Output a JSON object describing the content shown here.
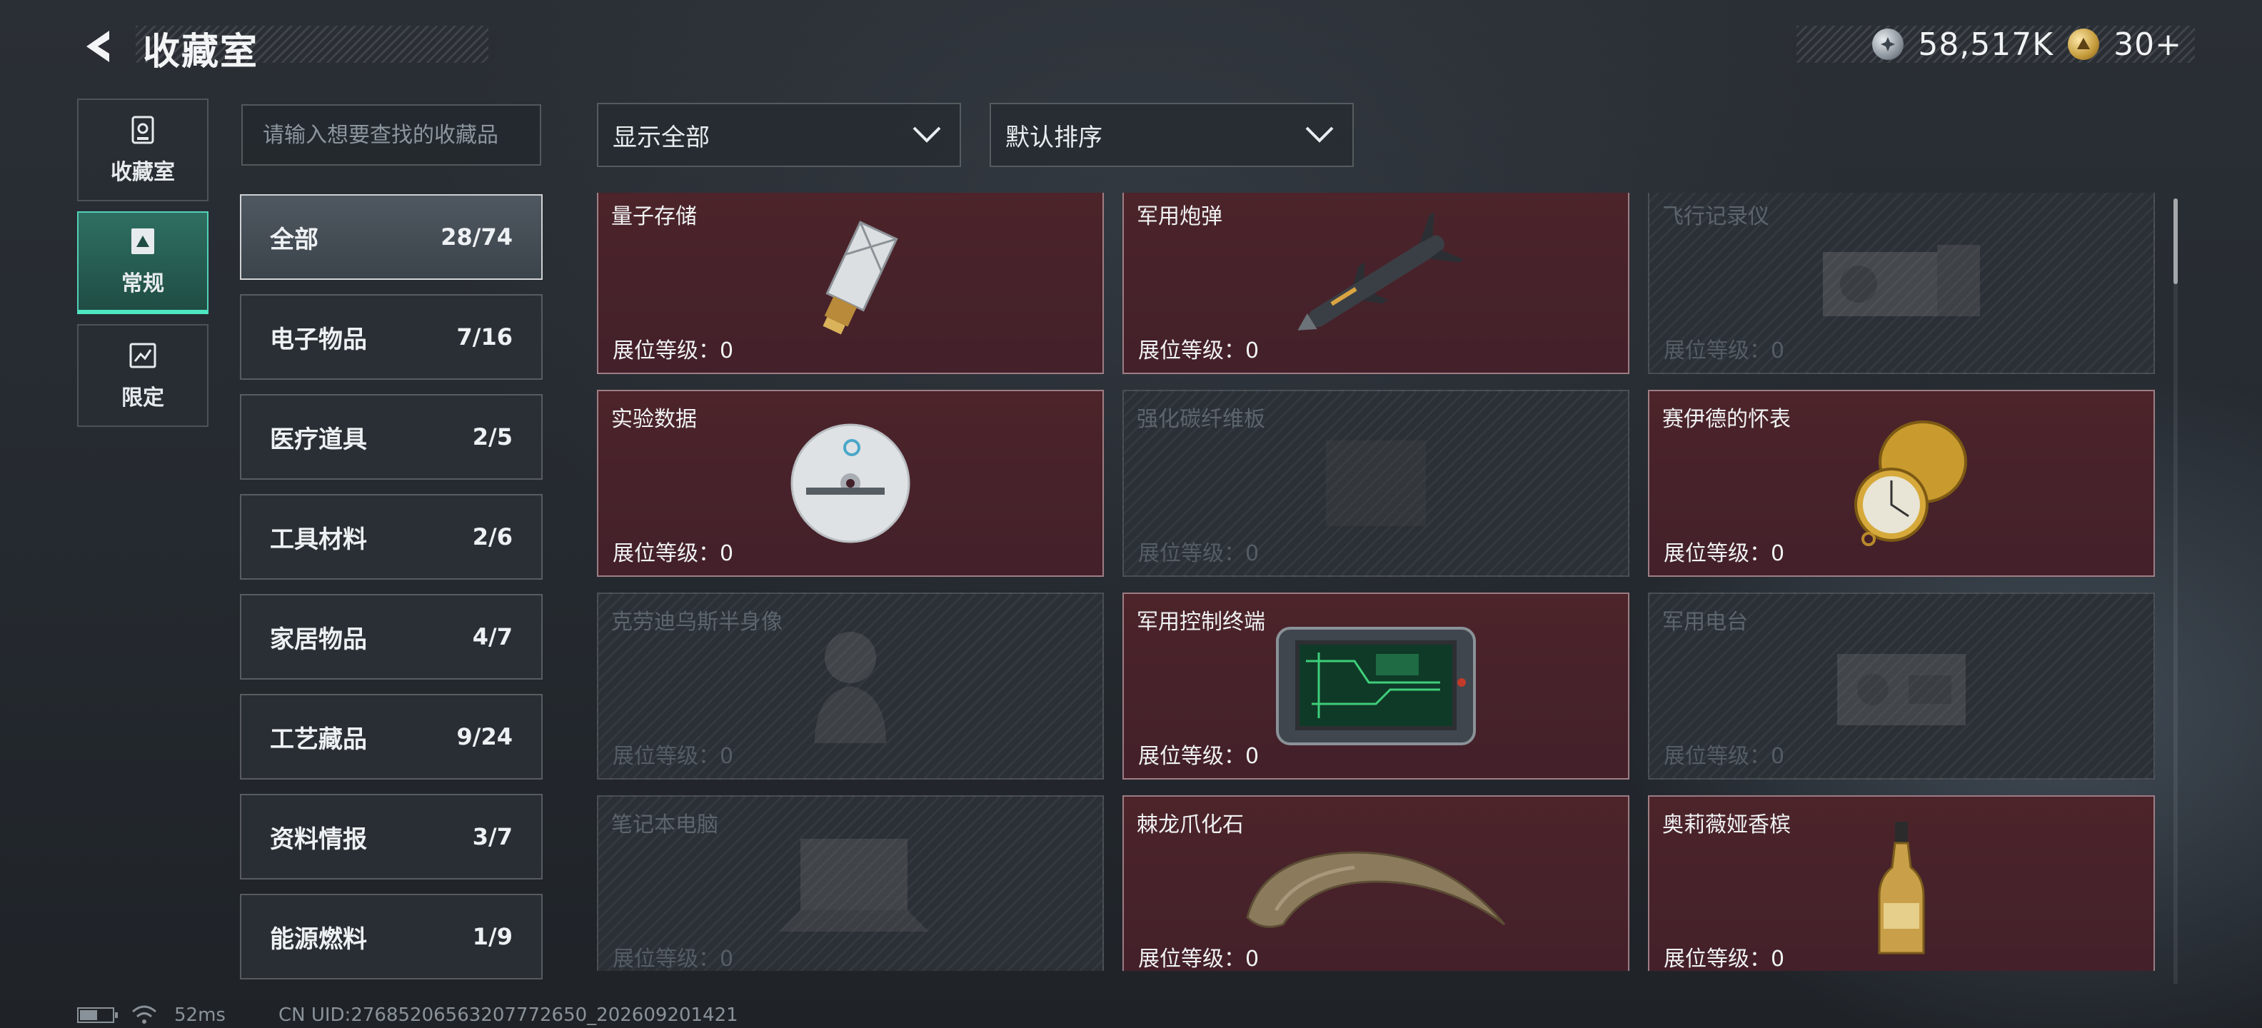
{
  "header": {
    "title": "收藏室",
    "currency": [
      {
        "icon": "silver-coin-icon",
        "value": "58,517K"
      },
      {
        "icon": "gold-coin-icon",
        "value": "30+"
      }
    ]
  },
  "left_nav": [
    {
      "label": "收藏室",
      "icon": "collection-room-icon",
      "active": false
    },
    {
      "label": "常规",
      "icon": "regular-icon",
      "active": true
    },
    {
      "label": "限定",
      "icon": "limited-icon",
      "active": false
    }
  ],
  "search": {
    "placeholder": "请输入想要查找的收藏品",
    "value": ""
  },
  "filters": {
    "filter_label": "显示全部",
    "sort_label": "默认排序"
  },
  "categories": [
    {
      "name": "全部",
      "count": "28/74",
      "active": true
    },
    {
      "name": "电子物品",
      "count": "7/16"
    },
    {
      "name": "医疗道具",
      "count": "2/5"
    },
    {
      "name": "工具材料",
      "count": "2/6"
    },
    {
      "name": "家居物品",
      "count": "4/7"
    },
    {
      "name": "工艺藏品",
      "count": "9/24"
    },
    {
      "name": "资料情报",
      "count": "3/7"
    },
    {
      "name": "能源燃料",
      "count": "1/9"
    }
  ],
  "items": [
    {
      "name": "量子存储",
      "level": "展位等级：0",
      "owned": true,
      "art": "usb-drive-icon"
    },
    {
      "name": "军用炮弹",
      "level": "展位等级：0",
      "owned": true,
      "art": "missile-icon"
    },
    {
      "name": "飞行记录仪",
      "level": "展位等级：0",
      "owned": false,
      "art": "flight-recorder-icon"
    },
    {
      "name": "实验数据",
      "level": "展位等级：0",
      "owned": true,
      "art": "disc-icon"
    },
    {
      "name": "强化碳纤维板",
      "level": "展位等级：0",
      "owned": false,
      "art": "carbon-plate-icon"
    },
    {
      "name": "赛伊德的怀表",
      "level": "展位等级：0",
      "owned": true,
      "art": "pocket-watch-icon"
    },
    {
      "name": "克劳迪乌斯半身像",
      "level": "展位等级：0",
      "owned": false,
      "art": "bust-icon"
    },
    {
      "name": "军用控制终端",
      "level": "展位等级：0",
      "owned": true,
      "art": "control-terminal-icon"
    },
    {
      "name": "军用电台",
      "level": "展位等级：0",
      "owned": false,
      "art": "radio-icon"
    },
    {
      "name": "笔记本电脑",
      "level": "展位等级：0",
      "owned": false,
      "art": "laptop-icon"
    },
    {
      "name": "棘龙爪化石",
      "level": "展位等级：0",
      "owned": true,
      "art": "claw-fossil-icon"
    },
    {
      "name": "奥莉薇娅香槟",
      "level": "展位等级：0",
      "owned": true,
      "art": "champagne-icon"
    }
  ],
  "footer": {
    "ping": "52ms",
    "uid": "CN UID:27685206563207772650_202609201421",
    "battery_level": 0.55
  }
}
